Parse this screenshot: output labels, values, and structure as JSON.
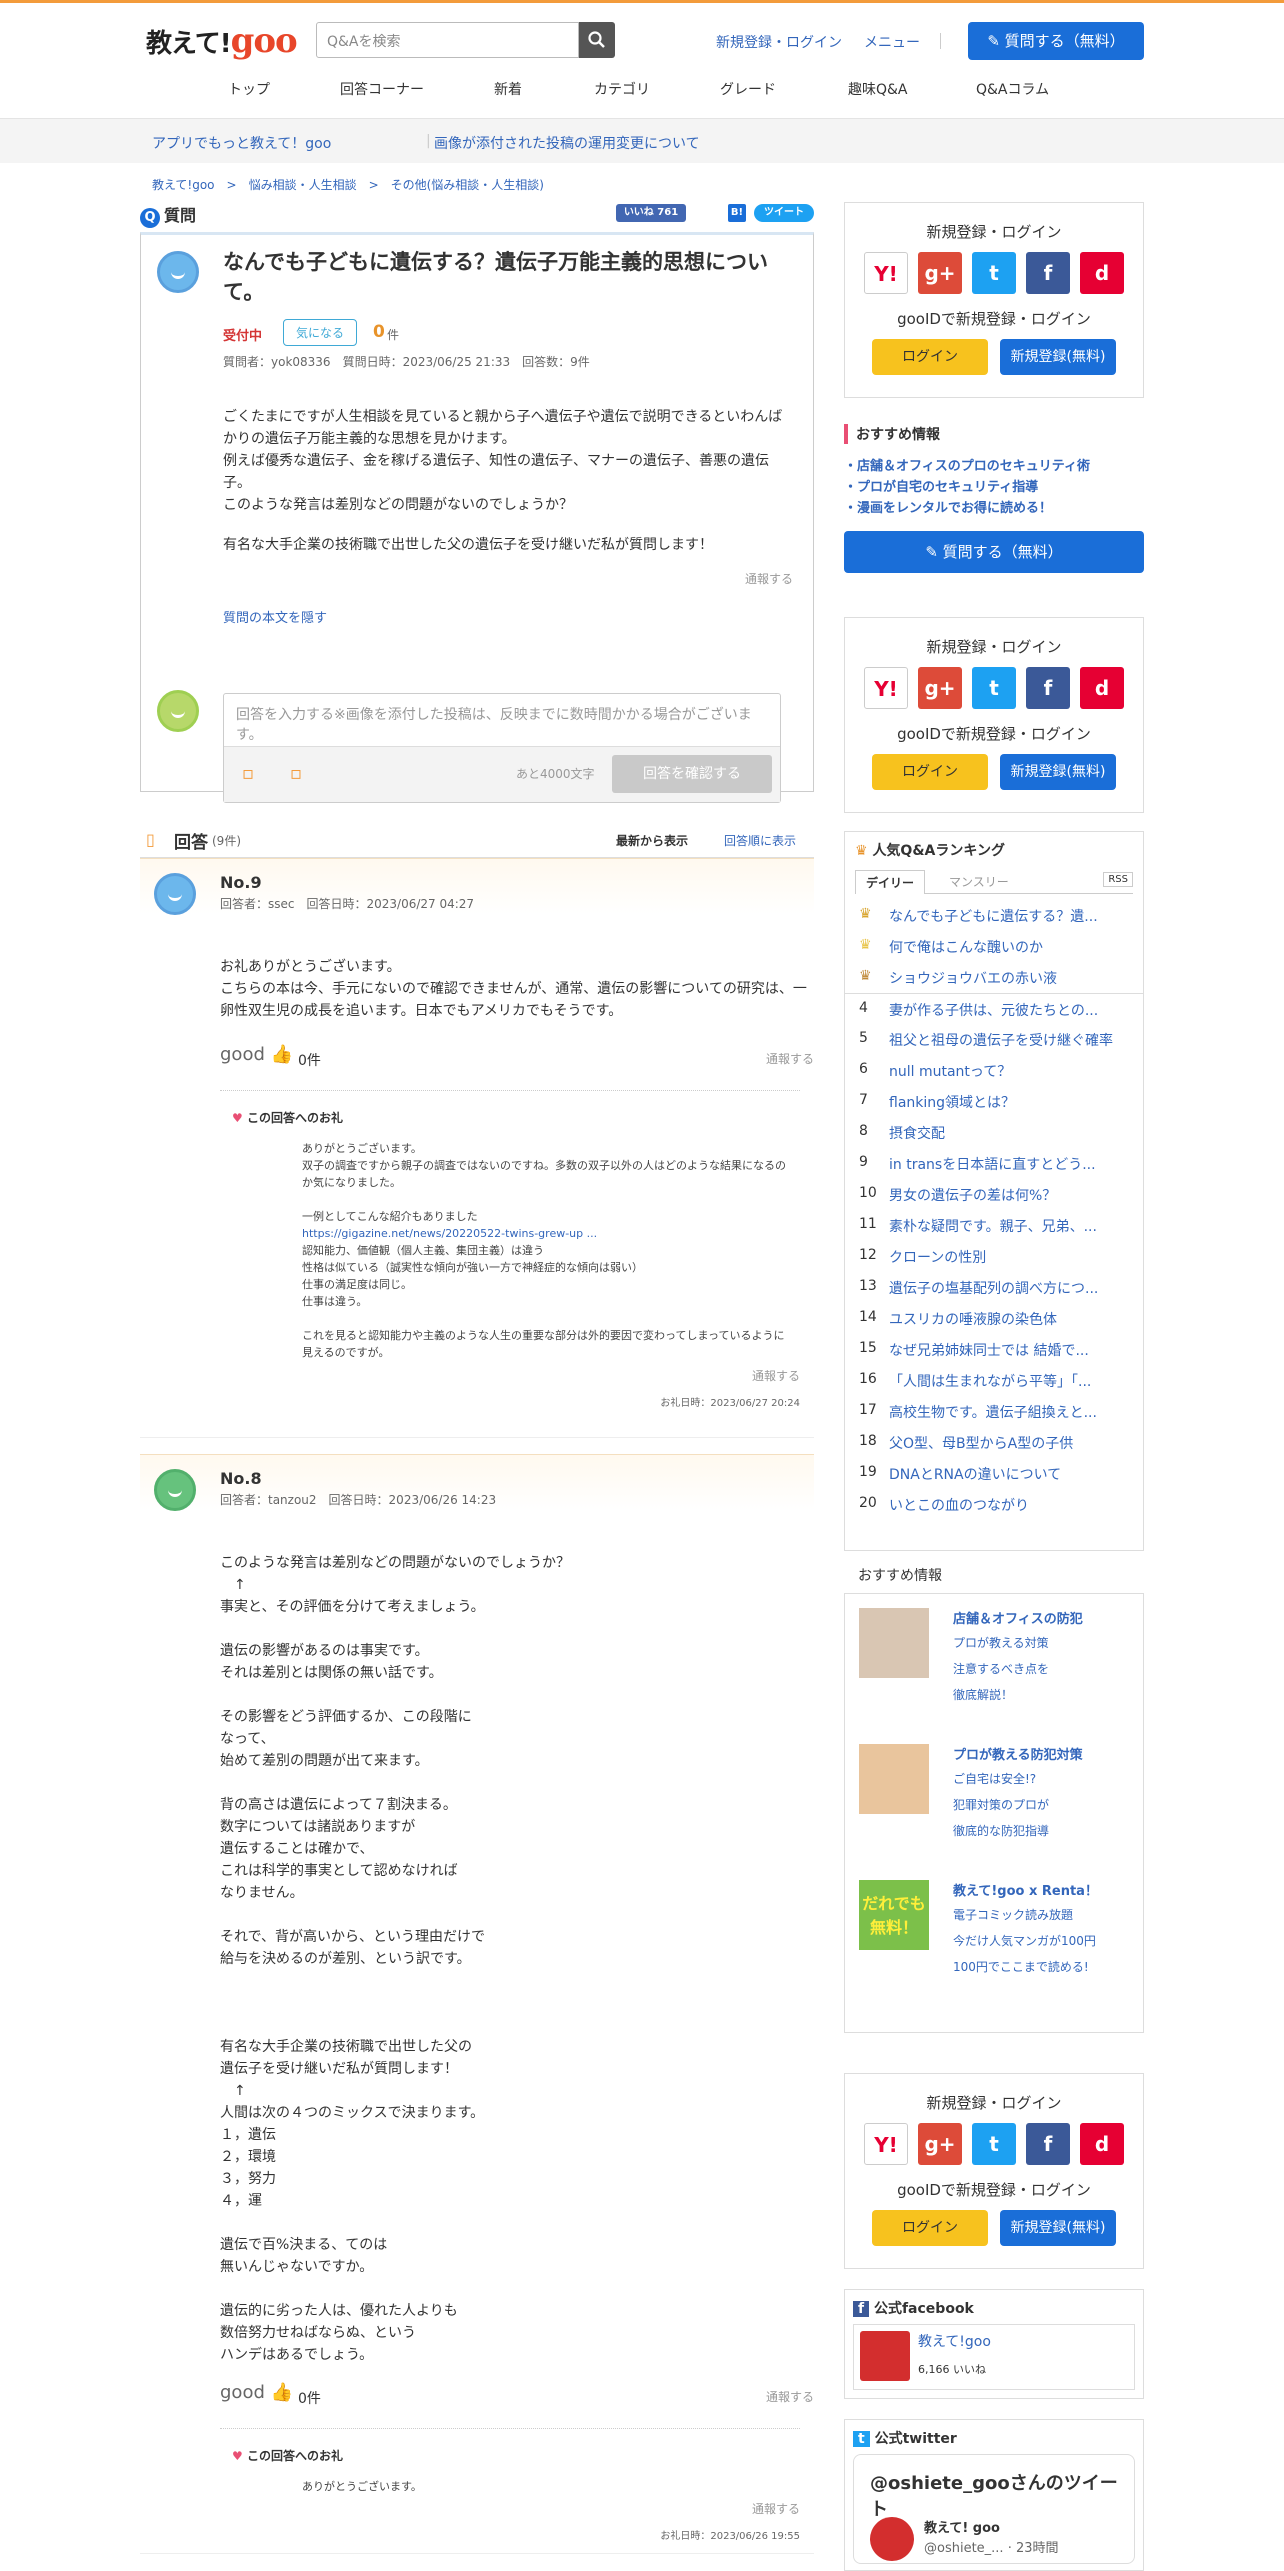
{
  "header": {
    "logo_text": "教えて!",
    "logo_goo": "goo",
    "search_placeholder": "Q&Aを検索",
    "signup": "新規登録・ログイン",
    "menu": "メニュー",
    "ask": "質問する（無料）"
  },
  "nav": [
    "トップ",
    "回答コーナー",
    "新着",
    "カテゴリ",
    "グレード",
    "趣味Q&A",
    "Q&Aコラム"
  ],
  "subbar": {
    "app": "アプリでもっと教えて！goo",
    "notice": "画像が添付された投稿の運用変更について"
  },
  "breadcrumb": "教えて!goo　>　悩み相談・人生相談　>　その他(悩み相談・人生相談)",
  "question": {
    "label": "質問",
    "like_count": "いいね 761",
    "title": "なんでも子どもに遺伝する？遺伝子万能主義的思想について。",
    "status": "受付中",
    "watch": "気になる",
    "watch_count": "0",
    "watch_unit": "件",
    "meta": "質問者：yok08336　質問日時：2023/06/25 21:33　回答数：9件",
    "body": [
      "ごくたまにですが人生相談を見ていると親から子へ遺伝子や遺伝で説明できるといわんばかりの遺伝子万能主義的な思想を見かけます。",
      "例えば優秀な遺伝子、金を稼げる遺伝子、知性の遺伝子、マナーの遺伝子、善悪の遺伝子。",
      "このような発言は差別などの問題がないのでしょうか？",
      "",
      "有名な大手企業の技術職で出世した父の遺伝子を受け継いだ私が質問します！"
    ],
    "report": "通報する",
    "hide": "質問の本文を隠す",
    "reply_placeholder": "回答を入力する※画像を添付した投稿は、反映までに数時間かかる場合がございます。",
    "remaining": "あと4000文字",
    "confirm": "回答を確認する"
  },
  "answers_head": {
    "title": "回答",
    "count": "(9件)",
    "newest": "最新から表示",
    "order": "回答順に表示"
  },
  "answers": [
    {
      "no": "No.9",
      "meta": "回答者：ssec　回答日時：2023/06/27 04:27",
      "body": [
        "お礼ありがとうございます。",
        "こちらの本は今、手元にないので確認できませんが、通常、遺伝の影響についての研究は、一卵性双生児の成長を追います。日本でもアメリカでもそうです。"
      ],
      "good": "good",
      "good_count": "0件",
      "report": "通報する",
      "thanks_label": "この回答へのお礼",
      "thanks": [
        "ありがとうございます。",
        "双子の調査ですから親子の調査ではないのですね。多数の双子以外の人はどのような結果になるのか気になりました。",
        "",
        "一例としてこんな紹介もありました",
        "https://gigazine.net/news/20220522-twins-grew-up ...",
        "認知能力、価値観（個人主義、集団主義）は違う",
        "性格は似ている（誠実性な傾向が強い一方で神経症的な傾向は弱い）",
        "仕事の満足度は同じ。",
        "仕事は違う。",
        "",
        "これを見ると認知能力や主義のような人生の重要な部分は外的要因で変わってしまっているように見えるのですが。"
      ],
      "thanks_report": "通報する",
      "thanks_date": "お礼日時：2023/06/27 20:24"
    },
    {
      "no": "No.8",
      "meta": "回答者：tanzou2　回答日時：2023/06/26 14:23",
      "body": [
        "このような発言は差別などの問題がないのでしょうか？",
        "　↑",
        "事実と、その評価を分けて考えましょう。",
        "",
        "遺伝の影響があるのは事実です。",
        "それは差別とは関係の無い話です。",
        "",
        "その影響をどう評価するか、この段階に",
        "なって、",
        "始めて差別の問題が出て来ます。",
        "",
        "背の高さは遺伝によって７割決まる。",
        "数字については諸説ありますが",
        "遺伝することは確かで、",
        "これは科学的事実として認めなければ",
        "なりません。",
        "",
        "それで、背が高いから、という理由だけで",
        "給与を決めるのが差別、という訳です。",
        "",
        "",
        "",
        "有名な大手企業の技術職で出世した父の",
        "遺伝子を受け継いだ私が質問します！",
        "　↑",
        "人間は次の４つのミックスで決まります。",
        "１，遺伝",
        "２，環境",
        "３，努力",
        "４，運",
        "",
        "遺伝で百%決まる、てのは",
        "無いんじゃないですか。",
        "",
        "遺伝的に劣った人は、優れた人よりも",
        "数倍努力せねばならぬ、という",
        "ハンデはあるでしょう。"
      ],
      "good": "good",
      "good_count": "0件",
      "report": "通報する",
      "thanks_label": "この回答へのお礼",
      "thanks": [
        "ありがとうございます。"
      ],
      "thanks_report": "通報する",
      "thanks_date": "お礼日時：2023/06/26 19:55"
    }
  ],
  "side": {
    "login_title": "新規登録・ログイン",
    "gooid": "gooIDで新規登録・ログイン",
    "login": "ログイン",
    "register": "新規登録(無料)",
    "sns": [
      {
        "label": "Y!",
        "color": "#ffffff"
      },
      {
        "label": "g+",
        "color": "#dd4b39"
      },
      {
        "label": "t",
        "color": "#1da1f2"
      },
      {
        "label": "f",
        "color": "#3b5998"
      },
      {
        "label": "d",
        "color": "#e60033"
      }
    ],
    "reco_title": "おすすめ情報",
    "reco": [
      "・店舗＆オフィスのプロのセキュリティ術",
      "・プロが自宅のセキュリティ指導",
      "・漫画をレンタルでお得に読める！"
    ],
    "ask": "質問する（無料）",
    "ranking_title": "人気Q&Aランキング",
    "tab_daily": "デイリー",
    "tab_monthly": "マンスリー",
    "rss": "RSS",
    "ranking": [
      "なんでも子どもに遺伝する？遺...",
      "何で俺はこんな醜いのか",
      "ショウジョウバエの赤い液",
      "妻が作る子供は、元彼たちとの...",
      "祖父と祖母の遺伝子を受け継ぐ確率",
      "null mutantって？",
      "flanking領域とは？",
      "摂食交配",
      "in transを日本語に直すとどう...",
      "男女の遺伝子の差は何%？",
      "素朴な疑問です。親子、兄弟、...",
      "クローンの性別",
      "遺伝子の塩基配列の調べ方につ...",
      "ユスリカの唾液腺の染色体",
      "なぜ兄弟姉妹同士では 結婚で...",
      "「人間は生まれながら平等」「...",
      "高校生物です。遺伝子組換えと...",
      "父O型、母B型からA型の子供",
      "DNAとRNAの違いについて",
      "いとこの血のつながり"
    ],
    "reco2_title": "おすすめ情報",
    "reco2": [
      {
        "head": "店舗＆オフィスの防犯",
        "items": [
          "プロが教える対策",
          "注意するべき点を",
          "徹底解説！"
        ]
      },
      {
        "head": "プロが教える防犯対策",
        "items": [
          "ご自宅は安全!?",
          "犯罪対策のプロが",
          "徹底的な防犯指導"
        ]
      },
      {
        "head": "教えて!goo x Renta！",
        "items": [
          "電子コミック読み放題",
          "今だけ人気マンガが100円",
          "100円でここまで読める!"
        ],
        "badge": "だれでも無料！"
      }
    ],
    "fb_title": "公式facebook",
    "fb_name": "教えて!goo",
    "fb_like": "6,166 いいね",
    "tw_title": "公式twitter",
    "tw_handle": "@oshiete_gooさんのツイート",
    "tw_name": "教えて! goo",
    "tw_user": "@oshiete_...",
    "tw_time": "23時間"
  }
}
